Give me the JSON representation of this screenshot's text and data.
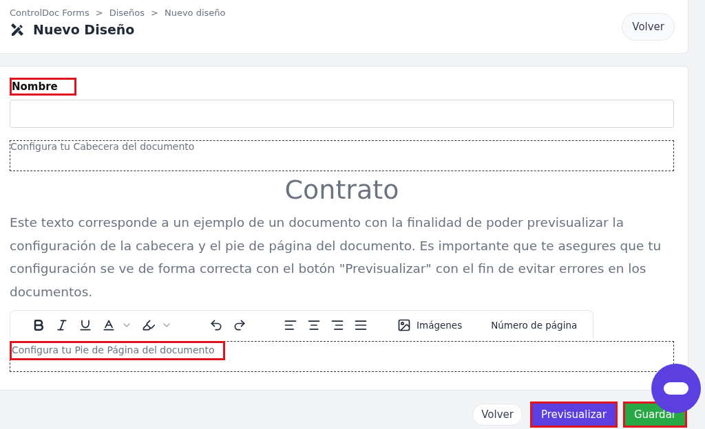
{
  "breadcrumb": [
    {
      "label": "ControlDoc Forms"
    },
    {
      "label": "Diseños"
    },
    {
      "label": "Nuevo diseño"
    }
  ],
  "breadcrumb_separator": ">",
  "title": "Nuevo Diseño",
  "header_button": "Volver",
  "form": {
    "name_label": "Nombre",
    "name_label_highlighted": true,
    "header_placeholder": "Configura tu Cabecera del documento",
    "document_title": "Contrato",
    "document_text": "Este texto corresponde a un ejemplo de un documento con la finalidad de poder previsualizar la configuración de la cabecera y el pie de página del documento. Es importante que te asegures que tu configuración se ve de forma correcta con el botón \"Previsualizar\" con el fin de evitar errores en los documentos.",
    "toolbar": [
      {
        "kind": "bold"
      },
      {
        "kind": "italic"
      },
      {
        "kind": "underline"
      },
      {
        "kind": "text-color"
      },
      {
        "kind": "highlight"
      },
      {
        "kind": "undo"
      },
      {
        "kind": "redo"
      },
      {
        "kind": "align-left"
      },
      {
        "kind": "align-center"
      },
      {
        "kind": "align-right"
      },
      {
        "kind": "justify"
      },
      {
        "kind": "images",
        "label": "Imágenes"
      },
      {
        "kind": "page-number",
        "label": "Número de página"
      }
    ],
    "footer_placeholder": "Configura tu Pie de Página del documento",
    "footer_placeholder_highlighted": true
  },
  "actions": [
    {
      "label": "Volver",
      "kind": "secondary",
      "highlighted": false
    },
    {
      "label": "Previsualizar",
      "kind": "primary",
      "highlighted": true
    },
    {
      "label": "Guardar",
      "kind": "success",
      "highlighted": true
    }
  ]
}
